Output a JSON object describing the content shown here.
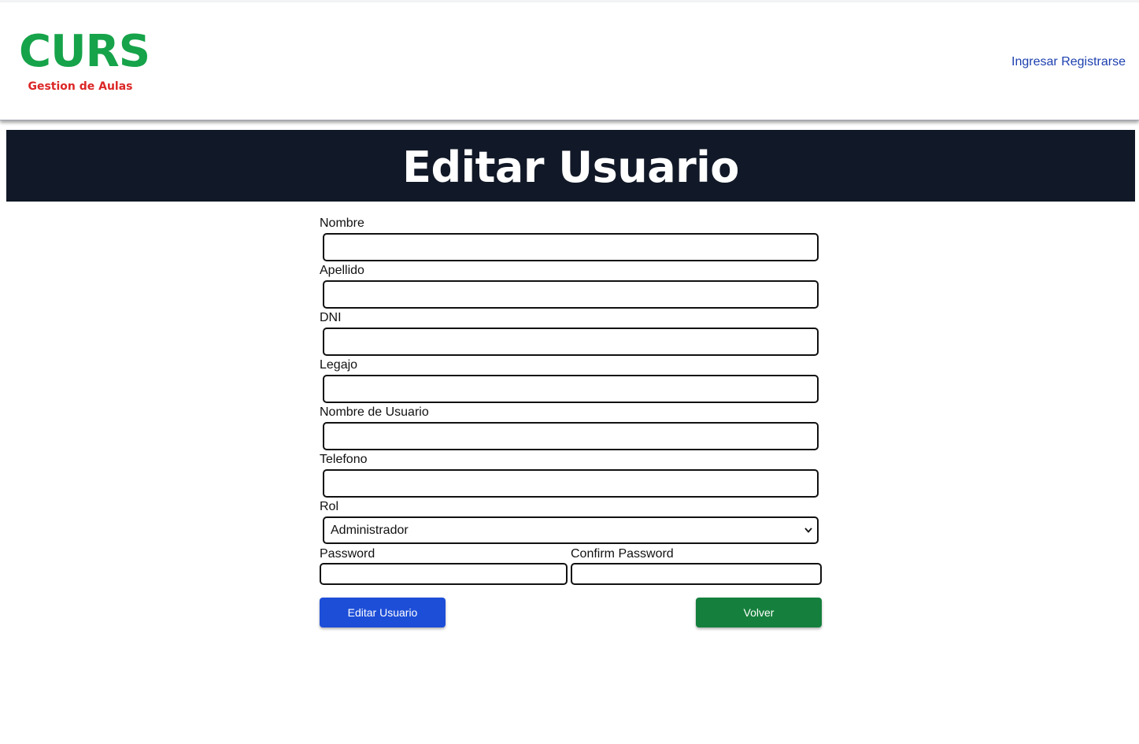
{
  "header": {
    "logo_title": "CURS",
    "logo_subtitle": "Gestion de Aulas",
    "nav": {
      "login": "Ingresar",
      "register": "Registrarse"
    }
  },
  "banner": {
    "title": "Editar Usuario"
  },
  "form": {
    "fields": [
      {
        "label": "Nombre",
        "value": ""
      },
      {
        "label": "Apellido",
        "value": ""
      },
      {
        "label": "DNI",
        "value": ""
      },
      {
        "label": "Legajo",
        "value": ""
      },
      {
        "label": "Nombre de Usuario",
        "value": ""
      },
      {
        "label": "Telefono",
        "value": ""
      }
    ],
    "rol": {
      "label": "Rol",
      "selected": "Administrador"
    },
    "password": {
      "label": "Password",
      "value": ""
    },
    "confirm_password": {
      "label": "Confirm Password",
      "value": ""
    },
    "buttons": {
      "submit": "Editar Usuario",
      "back": "Volver"
    }
  },
  "colors": {
    "logo_green": "#16a34a",
    "logo_red": "#dc2626",
    "nav_link": "#1e40af",
    "banner_bg": "#111827",
    "submit_button": "#1d4ed8",
    "back_button": "#15803d"
  }
}
